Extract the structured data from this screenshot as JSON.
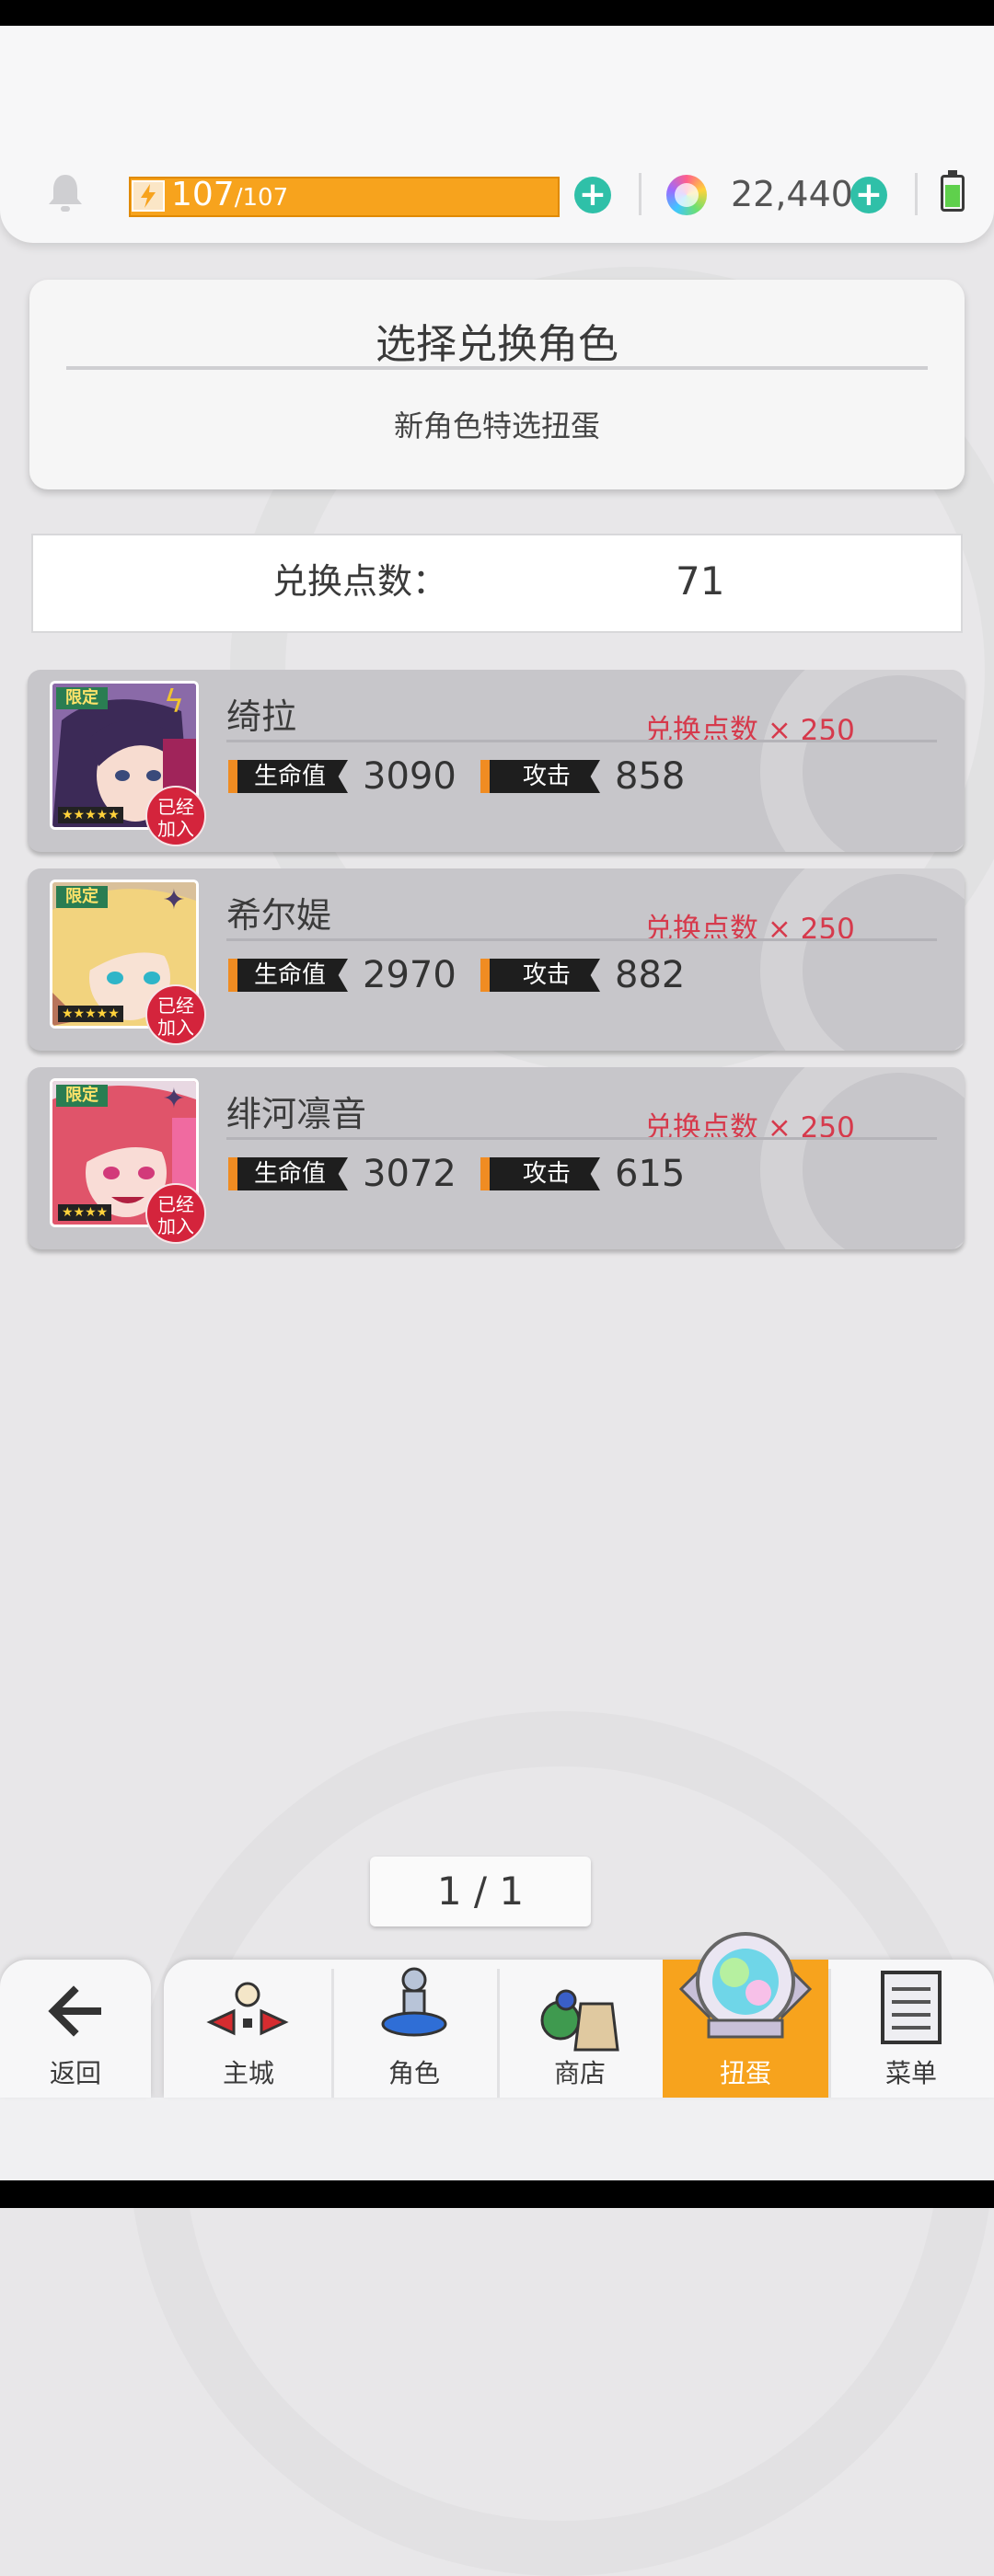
{
  "resources": {
    "stamina_current": "107",
    "stamina_max": "/107",
    "gems": "22,440",
    "plus": "+"
  },
  "header": {
    "title": "选择兑换角色",
    "subtitle": "新角色特选扭蛋"
  },
  "points": {
    "label": "兑换点数：",
    "value": "71"
  },
  "characters": [
    {
      "name": "绮拉",
      "cost": "兑换点数 × 250",
      "limited": "限定",
      "stars": "★★★★★",
      "hp_label": "生命值",
      "hp": "3090",
      "atk_label": "攻击",
      "atk": "858",
      "status": "已经加入",
      "element": "lightning-icon",
      "status_line1": "已经",
      "status_line2": "加入"
    },
    {
      "name": "希尔媞",
      "cost": "兑换点数 × 250",
      "limited": "限定",
      "stars": "★★★★★",
      "hp_label": "生命值",
      "hp": "2970",
      "atk_label": "攻击",
      "atk": "882",
      "status": "已经加入",
      "element": "dark-star-icon",
      "status_line1": "已经",
      "status_line2": "加入"
    },
    {
      "name": "绯河凛音",
      "cost": "兑换点数 × 250",
      "limited": "限定",
      "stars": "★★★★",
      "hp_label": "生命值",
      "hp": "3072",
      "atk_label": "攻击",
      "atk": "615",
      "status": "已经加入",
      "element": "dark-star-icon",
      "status_line1": "已经",
      "status_line2": "加入"
    }
  ],
  "pager": {
    "text": "1 / 1"
  },
  "nav": {
    "back": "返回",
    "items": [
      "主城",
      "角色",
      "商店",
      "扭蛋",
      "菜单"
    ],
    "active": "扭蛋"
  },
  "colors": {
    "accent": "#f7a31d",
    "plus": "#2fc0a8",
    "cost": "#d63a4c",
    "joined": "#d4243c"
  }
}
